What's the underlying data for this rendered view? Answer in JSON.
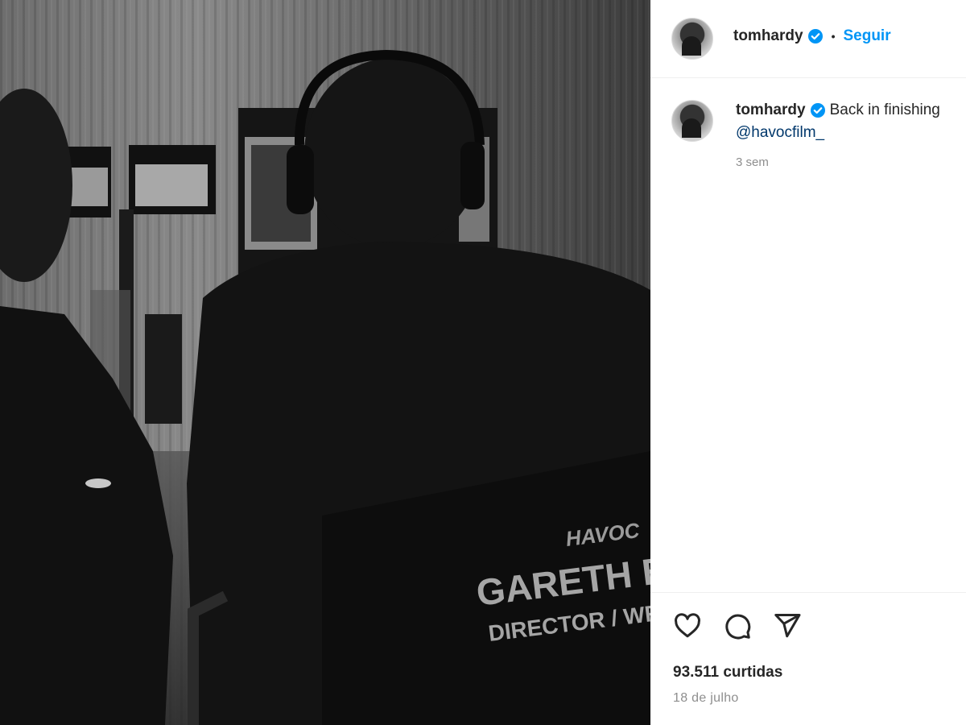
{
  "post": {
    "image_alt_text": "",
    "chair_text_line1": "GARETH EV",
    "chair_text_line2": "DIRECTOR / WR",
    "chair_logo_text": "HAVOC"
  },
  "header": {
    "username": "tomhardy",
    "separator": "•",
    "follow_label": "Seguir"
  },
  "caption": {
    "username": "tomhardy",
    "text": "Back in finishing",
    "mention": "@havocfilm_",
    "time_ago": "3 sem"
  },
  "footer": {
    "likes": "93.511 curtidas",
    "date": "18 de julho"
  },
  "icons": {
    "verified": "verified-badge-icon",
    "like": "heart-icon",
    "comment": "comment-icon",
    "share": "send-icon"
  },
  "colors": {
    "accent": "#0095f6",
    "verified": "#0095f6",
    "mention": "#00376b",
    "muted": "#8e8e8e"
  }
}
